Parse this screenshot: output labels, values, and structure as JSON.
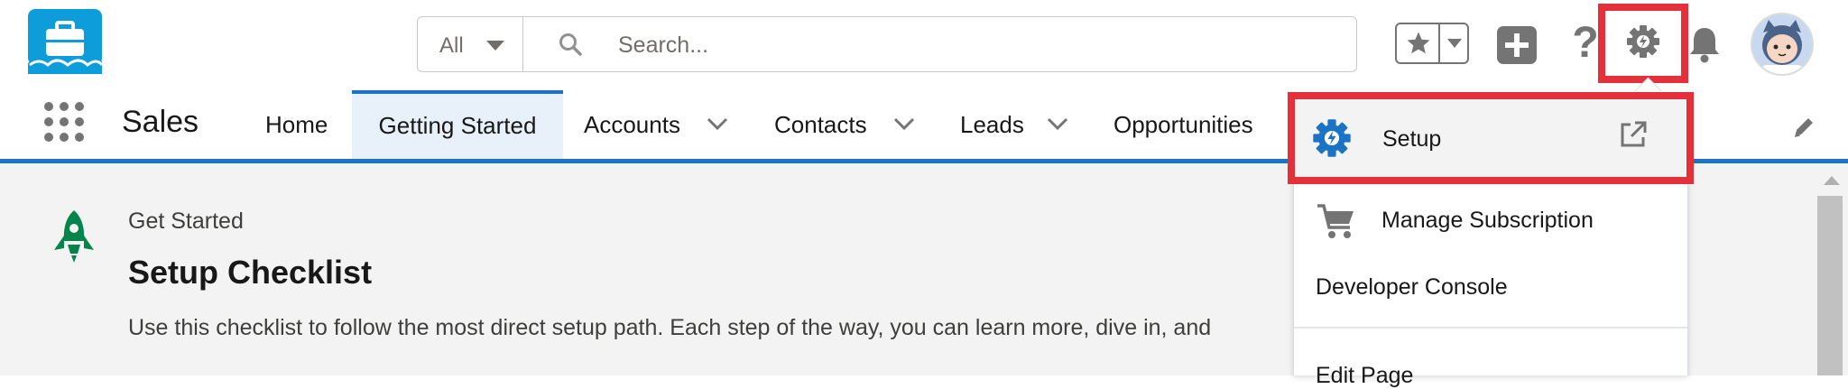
{
  "header": {
    "search": {
      "scope": "All",
      "placeholder": "Search..."
    }
  },
  "nav": {
    "app_name": "Sales",
    "items": [
      {
        "label": "Home"
      },
      {
        "label": "Getting Started",
        "active": true
      },
      {
        "label": "Accounts"
      },
      {
        "label": "Contacts"
      },
      {
        "label": "Leads"
      },
      {
        "label": "Opportunities"
      }
    ]
  },
  "main": {
    "eyebrow": "Get Started",
    "title": "Setup Checklist",
    "description": "Use this checklist to follow the most direct setup path. Each step of the way, you can learn more, dive in, and"
  },
  "menu": {
    "items": [
      {
        "label": "Setup"
      },
      {
        "label": "Manage Subscription"
      },
      {
        "label": "Developer Console"
      },
      {
        "label": "Edit Page"
      }
    ]
  },
  "colors": {
    "brand_blue": "#1b73c5",
    "highlight_red": "#e4303b",
    "rocket_green": "#04844b",
    "logo_blue": "#0d9dda"
  }
}
